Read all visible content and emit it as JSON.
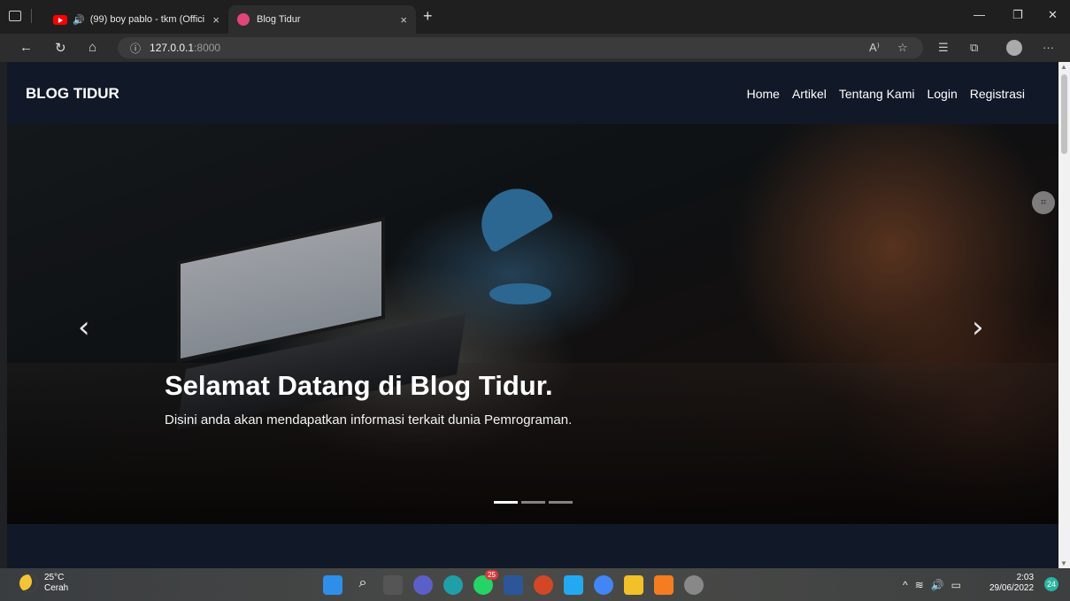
{
  "browser": {
    "tabs": [
      {
        "title": "(99) boy pablo - tkm (Offici",
        "icon": "youtube-icon",
        "audio": "speaker-icon"
      },
      {
        "title": "Blog Tidur",
        "icon": "blog-favicon"
      }
    ],
    "new_tab": "+",
    "close": "×",
    "url_host": "127.0.0.1",
    "url_port": ":8000",
    "info": "ⓘ"
  },
  "site": {
    "brand": "BLOG TIDUR",
    "menu": [
      "Home",
      "Artikel",
      "Tentang Kami",
      "Login",
      "Registrasi"
    ]
  },
  "carousel": {
    "title": "Selamat Datang di Blog Tidur.",
    "subtitle": "Disini anda akan mendapatkan informasi terkait dunia Pemrograman.",
    "prev": "‹",
    "next": "›",
    "slide_count": 3,
    "active_slide": 1
  },
  "taskbar": {
    "temperature": "25°C",
    "condition": "Cerah",
    "whatsapp_badge": "25",
    "time": "2:03",
    "date": "29/06/2022",
    "notifications": "24"
  }
}
